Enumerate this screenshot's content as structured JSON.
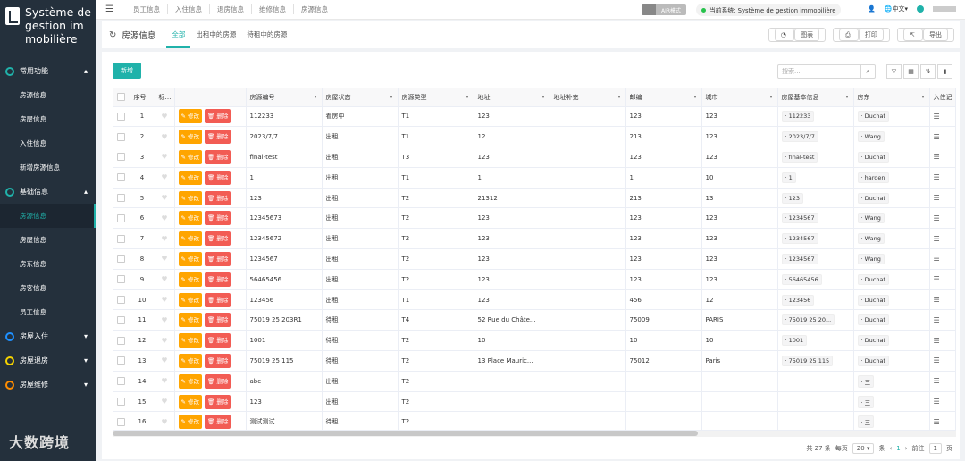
{
  "app": {
    "title": "Système de gestion immobilière"
  },
  "sidebar": {
    "groups": [
      {
        "label": "常用功能",
        "items": [
          "房源信息",
          "房屋信息",
          "入住信息",
          "新增房源信息"
        ],
        "color": "#20b2aa"
      },
      {
        "label": "基础信息",
        "items": [
          "房源信息",
          "房屋信息",
          "房东信息",
          "房客信息",
          "员工信息"
        ],
        "color": "#20b2aa"
      },
      {
        "label": "房屋入住",
        "items": [],
        "color": "#1e90ff"
      },
      {
        "label": "房屋退房",
        "items": [],
        "color": "#f5d300"
      },
      {
        "label": "房屋维修",
        "items": [],
        "color": "#ff8c00"
      }
    ]
  },
  "topbar": {
    "nav": [
      "员工信息",
      "入住信息",
      "退房信息",
      "维修信息",
      "房源信息"
    ],
    "air_mode": "AIR模式",
    "system": "当前系统: Système de gestion immobilière",
    "lang": "中文"
  },
  "page": {
    "title": "房源信息",
    "tabs": [
      "全部",
      "出租中的房源",
      "待租中的房源"
    ],
    "actions": [
      "图表",
      "打印",
      "导出"
    ],
    "new_button": "新增",
    "search_placeholder": "搜索..."
  },
  "table": {
    "headers": [
      "序号",
      "标签",
      "",
      "房源编号",
      "房屋状态",
      "房源类型",
      "地址",
      "地址补充",
      "邮编",
      "城市",
      "房屋基本信息",
      "房东",
      "入住记"
    ],
    "edit_label": "修改",
    "delete_label": "删除",
    "rows": [
      [
        "1",
        "112233",
        "看房中",
        "T1",
        "123",
        "",
        "123",
        "123",
        "112233",
        "Duchat"
      ],
      [
        "2",
        "2023/7/7",
        "出租",
        "T1",
        "12",
        "",
        "213",
        "123",
        "2023/7/7",
        "Wang"
      ],
      [
        "3",
        "final-test",
        "出租",
        "T3",
        "123",
        "",
        "123",
        "123",
        "final-test",
        "Duchat"
      ],
      [
        "4",
        "1",
        "出租",
        "T1",
        "1",
        "",
        "1",
        "10",
        "1",
        "harden"
      ],
      [
        "5",
        "123",
        "出租",
        "T2",
        "21312",
        "",
        "213",
        "13",
        "123",
        "Duchat"
      ],
      [
        "6",
        "12345673",
        "出租",
        "T2",
        "123",
        "",
        "123",
        "123",
        "1234567",
        "Wang"
      ],
      [
        "7",
        "12345672",
        "出租",
        "T2",
        "123",
        "",
        "123",
        "123",
        "1234567",
        "Wang"
      ],
      [
        "8",
        "1234567",
        "出租",
        "T2",
        "123",
        "",
        "123",
        "123",
        "1234567",
        "Wang"
      ],
      [
        "9",
        "56465456",
        "出租",
        "T2",
        "123",
        "",
        "123",
        "123",
        "56465456",
        "Duchat"
      ],
      [
        "10",
        "123456",
        "出租",
        "T1",
        "123",
        "",
        "456",
        "12",
        "123456",
        "Duchat"
      ],
      [
        "11",
        "75019 25 203R1",
        "待租",
        "T4",
        "52 Rue du Châte...",
        "",
        "75009",
        "PARIS",
        "75019 25 20...",
        "Duchat"
      ],
      [
        "12",
        "1001",
        "待租",
        "T2",
        "10",
        "",
        "10",
        "10",
        "1001",
        "Duchat"
      ],
      [
        "13",
        "75019 25 115",
        "待租",
        "T2",
        "13 Place Mauric...",
        "",
        "75012",
        "Paris",
        "75019 25 115",
        "Duchat"
      ],
      [
        "14",
        "abc",
        "出租",
        "T2",
        "",
        "",
        "",
        "",
        "",
        "三"
      ],
      [
        "15",
        "123",
        "出租",
        "T2",
        "",
        "",
        "",
        "",
        "",
        "三"
      ],
      [
        "16",
        "测试测试",
        "待租",
        "T2",
        "",
        "",
        "",
        "",
        "",
        "三"
      ]
    ]
  },
  "pager": {
    "total": "共 27 条",
    "per_page_label": "每页",
    "per_page": "20",
    "unit": "条",
    "goto": "前往",
    "page": "1",
    "page_unit": "页"
  },
  "watermark": "大数跨境"
}
